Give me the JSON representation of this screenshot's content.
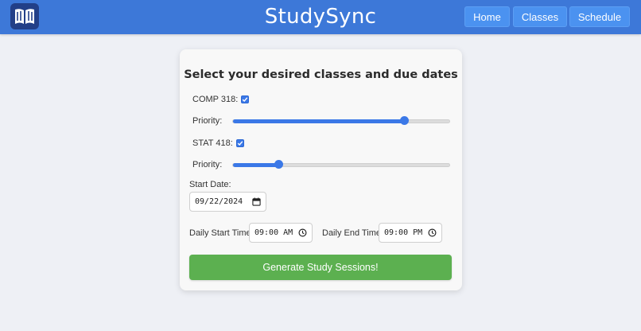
{
  "header": {
    "brand": "StudySync",
    "logo_icon": "open-book-icon",
    "nav": {
      "home": "Home",
      "classes": "Classes",
      "schedule": "Schedule"
    }
  },
  "form": {
    "title": "Select your desired classes and due dates",
    "classes": [
      {
        "label": "COMP 318:",
        "checked": true,
        "priority_label": "Priority:",
        "priority_fraction": 0.79
      },
      {
        "label": "STAT 418:",
        "checked": true,
        "priority_label": "Priority:",
        "priority_fraction": 0.21
      }
    ],
    "start_date": {
      "label": "Start Date:",
      "value": "09/22/2024"
    },
    "daily_start": {
      "label": "Daily Start Time:",
      "value": "09:00 AM"
    },
    "daily_end": {
      "label": "Daily End Time:",
      "value": "09:00 PM"
    },
    "submit_label": "Generate Study Sessions!"
  },
  "colors": {
    "header_bg": "#3d78d8",
    "nav_button": "#4b92f0",
    "accent_blue": "#3b78e7",
    "submit_green": "#5cb050",
    "page_bg": "#eef0f5"
  }
}
